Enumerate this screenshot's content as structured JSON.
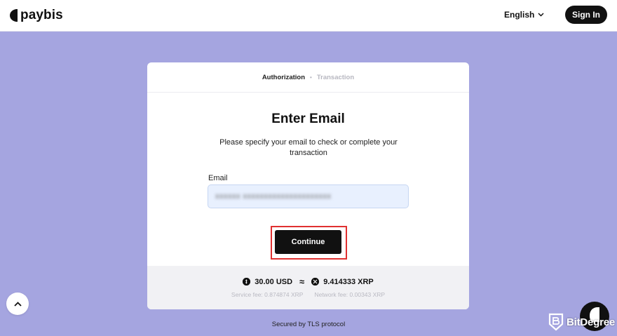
{
  "header": {
    "brand": "paybis",
    "language": "English",
    "signin_label": "Sign In"
  },
  "steps": {
    "active": "Authorization",
    "separator": "•",
    "inactive": "Transaction"
  },
  "form": {
    "title": "Enter Email",
    "description": "Please specify your email to check or complete your transaction",
    "email_label": "Email",
    "email_value": "xxxxxx xxxxxxxxxxxxxxxxxxxxx",
    "continue_label": "Continue"
  },
  "summary": {
    "from_amount": "30.00 USD",
    "approx": "≈",
    "to_amount": "9.414333 XRP",
    "service_fee": "Service fee: 0.874874 XRP",
    "network_fee": "Network fee: 0.00343 XRP"
  },
  "footer": {
    "secured": "Secured by TLS protocol"
  },
  "watermark": {
    "text": "BitDegree"
  },
  "colors": {
    "background": "#a5a5e0",
    "primary": "#111111",
    "highlight": "#e03030",
    "input_bg": "#e8f0fe"
  }
}
